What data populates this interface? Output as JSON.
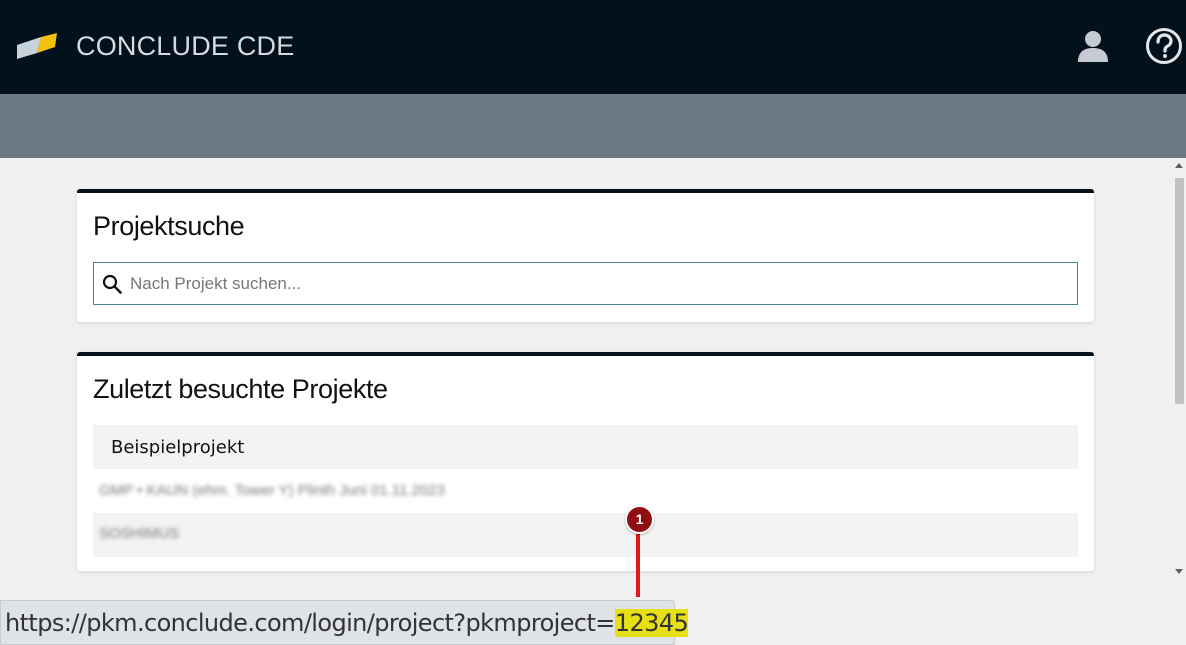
{
  "header": {
    "app_title": "CONCLUDE CDE",
    "logo_icon": "conclude-logo-icon",
    "user_icon": "user-icon",
    "help_icon": "help-circle-icon"
  },
  "search_card": {
    "title": "Projektsuche",
    "search_icon": "search-icon",
    "placeholder": "Nach Projekt suchen..."
  },
  "recent_card": {
    "title": "Zuletzt besuchte Projekte",
    "projects": [
      "Beispielprojekt",
      "GMP • KAUN (ehm. Tower Y) Plinth Juni 01.11.2023",
      "SOSHIMUS"
    ]
  },
  "status_bar": {
    "url_prefix": "https://pkm.conclude.com/login/project?pkmproject=",
    "project_id": "12345"
  },
  "annotation": {
    "badge_number": "1"
  },
  "colors": {
    "header_bg": "#02111b",
    "subbar_bg": "#697882",
    "accent_yellow": "#f4c20d",
    "callout_red": "#e0191b",
    "highlight": "#e6e014"
  }
}
